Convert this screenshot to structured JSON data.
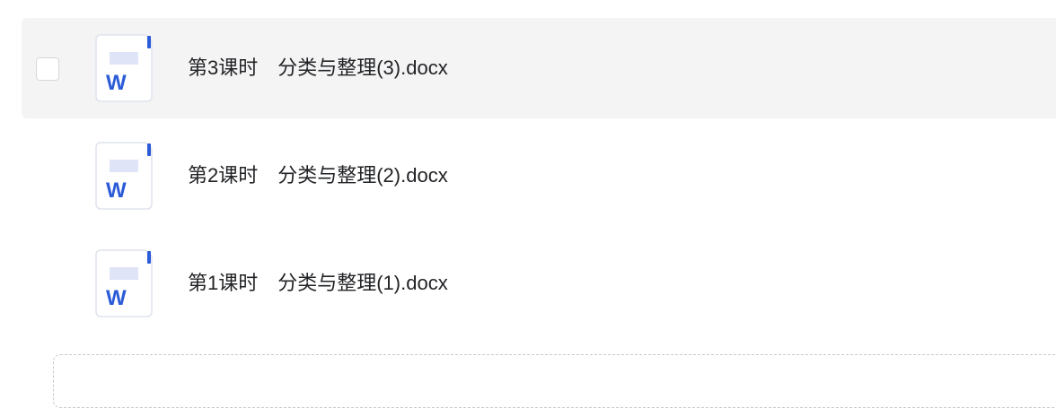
{
  "files": [
    {
      "name": "第3课时　分类与整理(3).docx",
      "selected": true,
      "icon": "word-doc-icon",
      "icon_letter": "W"
    },
    {
      "name": "第2课时　分类与整理(2).docx",
      "selected": false,
      "icon": "word-doc-icon",
      "icon_letter": "W"
    },
    {
      "name": "第1课时　分类与整理(1).docx",
      "selected": false,
      "icon": "word-doc-icon",
      "icon_letter": "W"
    }
  ],
  "colors": {
    "row_hover_bg": "#f4f4f5",
    "word_blue": "#2b5bd7",
    "icon_band": "#dfe4f7",
    "icon_border": "#dfe3ee",
    "text": "#222326"
  }
}
